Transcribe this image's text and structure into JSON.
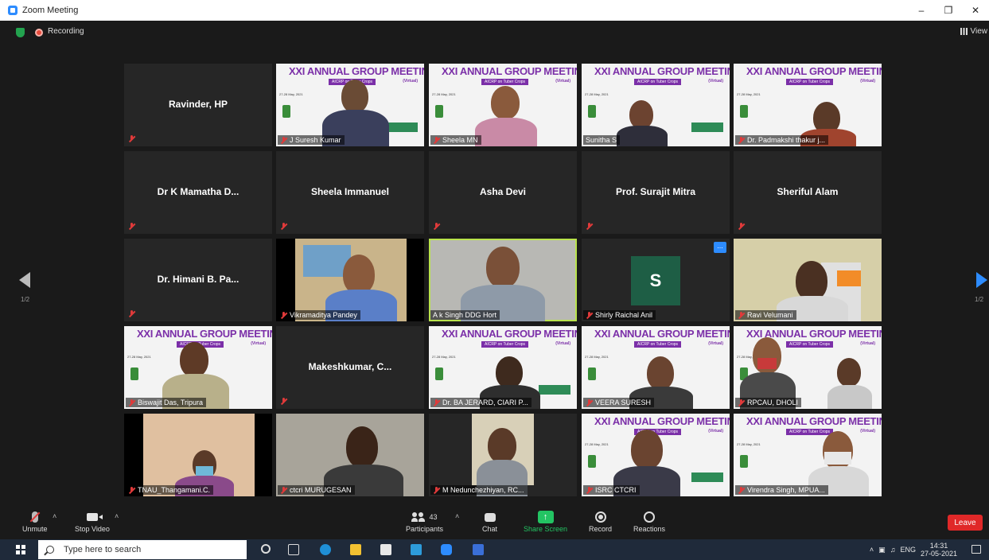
{
  "window": {
    "title": "Zoom Meeting"
  },
  "topbar": {
    "recording_label": "Recording",
    "view_label": "View"
  },
  "pager": {
    "left": "1/2",
    "right": "1/2"
  },
  "banner": {
    "title": "XXI ANNUAL GROUP MEETING",
    "subtitle": "AICRP on Tuber Crops",
    "virtual": "(Virtual)",
    "date": "27-28 May, 2021"
  },
  "tiles": [
    {
      "name": "Ravinder, HP"
    },
    {
      "name": "J Suresh Kumar"
    },
    {
      "name": "Sheela MN"
    },
    {
      "name": "Sunitha S"
    },
    {
      "name": "Dr. Padmakshi thakur j..."
    },
    {
      "name": "Dr K Mamatha D..."
    },
    {
      "name": "Sheela Immanuel"
    },
    {
      "name": "Asha Devi"
    },
    {
      "name": "Prof. Surajit Mitra"
    },
    {
      "name": "Sheriful Alam"
    },
    {
      "name": "Dr. Himani B. Pa..."
    },
    {
      "name": "Vikramaditya Pandey"
    },
    {
      "name": "A k  Singh DDG Hort"
    },
    {
      "name": "Shirly Raichal Anil",
      "avatar": "S",
      "more": "..."
    },
    {
      "name": "Ravi Velumani"
    },
    {
      "name": "Biswajit Das, Tripura"
    },
    {
      "name": "Makeshkumar, C..."
    },
    {
      "name": "Dr. BA JERARD, CIARI P..."
    },
    {
      "name": "VEERA SURESH"
    },
    {
      "name": "RPCAU, DHOLI"
    },
    {
      "name": "TNAU_Thangamani.C."
    },
    {
      "name": "ctcri MURUGESAN"
    },
    {
      "name": "M Nedunchezhiyan, RC..."
    },
    {
      "name": "ISRC CTCRI"
    },
    {
      "name": "Virendra Singh, MPUA..."
    }
  ],
  "toolbar": {
    "unmute": "Unmute",
    "stop_video": "Stop Video",
    "participants": "Participants",
    "participants_count": "43",
    "chat": "Chat",
    "share_screen": "Share Screen",
    "record": "Record",
    "reactions": "Reactions",
    "leave": "Leave"
  },
  "taskbar": {
    "search_placeholder": "Type here to search",
    "language": "ENG",
    "time": "14:31",
    "date": "27-05-2021"
  },
  "colors": {
    "active_speaker": "#b9e34c",
    "share": "#23c463",
    "leave": "#e02828",
    "banner_purple": "#7b2fa8"
  }
}
